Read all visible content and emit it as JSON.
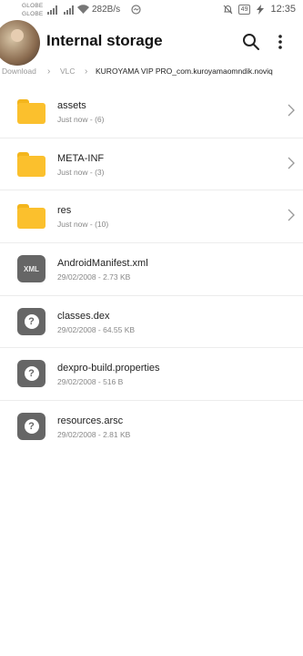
{
  "status_bar": {
    "carrier1": "GLOBE",
    "carrier2": "GLOBE",
    "net_speed": "282B/s",
    "battery": "49",
    "time": "12:35"
  },
  "toolbar": {
    "title": "Internal storage",
    "search_icon": "search-icon",
    "more_icon": "more-vert-icon"
  },
  "breadcrumb": {
    "items": [
      "Download",
      "VLC",
      "KUROYAMA VIP PRO_com.kuroyamaomndik.noviq"
    ]
  },
  "files": [
    {
      "name": "assets",
      "meta": "Just now - (6)",
      "type": "folder"
    },
    {
      "name": "META-INF",
      "meta": "Just now - (3)",
      "type": "folder"
    },
    {
      "name": "res",
      "meta": "Just now - (10)",
      "type": "folder"
    },
    {
      "name": "AndroidManifest.xml",
      "meta": "29/02/2008 - 2.73 KB",
      "type": "xml",
      "icon_label": "XML"
    },
    {
      "name": "classes.dex",
      "meta": "29/02/2008 - 64.55 KB",
      "type": "unknown",
      "icon_label": "?"
    },
    {
      "name": "dexpro-build.properties",
      "meta": "29/02/2008 - 516 B",
      "type": "unknown",
      "icon_label": "?"
    },
    {
      "name": "resources.arsc",
      "meta": "29/02/2008 - 2.81 KB",
      "type": "unknown",
      "icon_label": "?"
    }
  ],
  "colors": {
    "folder": "#fbc02d",
    "file_icon": "#666666"
  }
}
